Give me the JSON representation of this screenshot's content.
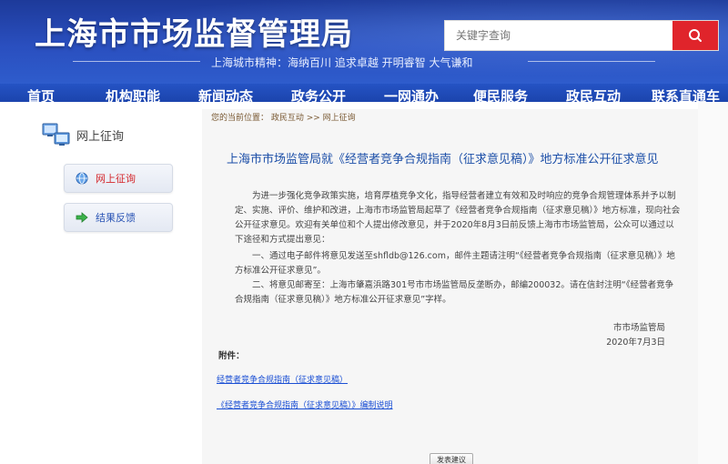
{
  "header": {
    "site_title": "上海市市场监督管理局",
    "spirit_text": "上海城市精神：海纳百川  追求卓越  开明睿智  大气谦和",
    "search_placeholder": "关键字查询"
  },
  "nav": {
    "items": [
      {
        "label": "首页"
      },
      {
        "label": "机构职能"
      },
      {
        "label": "新闻动态"
      },
      {
        "label": "政务公开"
      },
      {
        "label": "一网通办"
      },
      {
        "label": "便民服务"
      },
      {
        "label": "政民互动"
      },
      {
        "label": "联系直通车"
      }
    ]
  },
  "sidebar": {
    "heading": "网上征询",
    "buttons": [
      {
        "label": "网上征询",
        "active": true
      },
      {
        "label": "结果反馈",
        "active": false
      }
    ]
  },
  "main": {
    "breadcrumb": "您的当前位置：  政民互动 >> 网上征询",
    "title": "上海市市场监管局就《经营者竞争合规指南（征求意见稿）》地方标准公开征求意见",
    "paragraphs": [
      "为进一步强化竞争政策实施，培育厚植竞争文化，指导经营者建立有效和及时响应的竞争合规管理体系并予以制定、实施、评价、维护和改进，上海市市场监管局起草了《经营者竞争合规指南（征求意见稿）》地方标准，现向社会公开征求意见。欢迎有关单位和个人提出修改意见，并于2020年8月3日前反馈上海市市场监管局，公众可以通过以下途径和方式提出意见：",
      "一、通过电子邮件将意见发送至shfldb@126.com，邮件主题请注明“《经营者竞争合规指南（征求意见稿）》地方标准公开征求意见”。",
      "二、将意见邮寄至：上海市肇嘉浜路301号市市场监管局反垄断办，邮编200032。请在信封注明“《经营者竞争合规指南（征求意见稿）》地方标准公开征求意见”字样。"
    ],
    "signature_org": "市市场监管局",
    "signature_date": "2020年7月3日",
    "attachment_label": "附件：",
    "attachments": [
      "经营者竞争合规指南（征求意见稿）",
      "《经营者竞争合规指南（征求意见稿）》编制说明"
    ],
    "feedback_button": "发表建议"
  },
  "colors": {
    "header_blue": "#2a4fbf",
    "search_red": "#e0242b",
    "title_blue": "#1c4fa8",
    "active_red": "#d4262b",
    "link_blue": "#1a4fd4"
  },
  "icons": {
    "search": "search-icon",
    "computers": "computers-icon",
    "globe": "globe-icon",
    "arrow": "green-arrow-icon"
  }
}
